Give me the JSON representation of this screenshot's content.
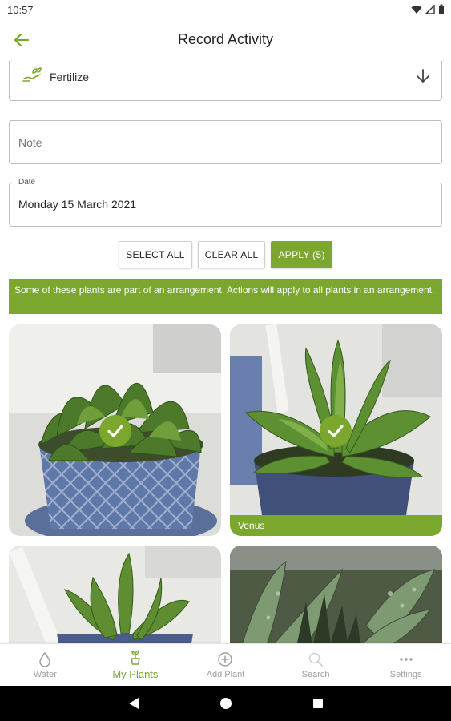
{
  "status_bar": {
    "time": "10:57"
  },
  "app_bar": {
    "title": "Record Activity"
  },
  "activity": {
    "label": "Fertilize"
  },
  "note": {
    "placeholder": "Note",
    "value": ""
  },
  "date": {
    "legend": "Date",
    "value": "Monday 15 March 2021"
  },
  "actions": {
    "select_all": "SELECT ALL",
    "clear_all": "CLEAR ALL",
    "apply": "APPLY (5)"
  },
  "banner": {
    "text": "Some of these plants are part of an arrangement. Actions will apply to all plants in an arrangement."
  },
  "plants": [
    {
      "name": "",
      "selected": true
    },
    {
      "name": "Venus",
      "selected": true
    },
    {
      "name": "",
      "selected": true
    },
    {
      "name": "",
      "selected": true
    }
  ],
  "bottom_nav": {
    "items": [
      {
        "label": "Water",
        "icon": "water-drop-icon",
        "active": false
      },
      {
        "label": "My Plants",
        "icon": "plant-pot-icon",
        "active": true
      },
      {
        "label": "Add Plant",
        "icon": "add-circle-icon",
        "active": false
      },
      {
        "label": "Search",
        "icon": "search-icon",
        "active": false
      },
      {
        "label": "Settings",
        "icon": "more-dots-icon",
        "active": false
      }
    ]
  },
  "colors": {
    "accent": "#7ca72e",
    "text": "#222222",
    "muted": "#9e9e9e"
  }
}
